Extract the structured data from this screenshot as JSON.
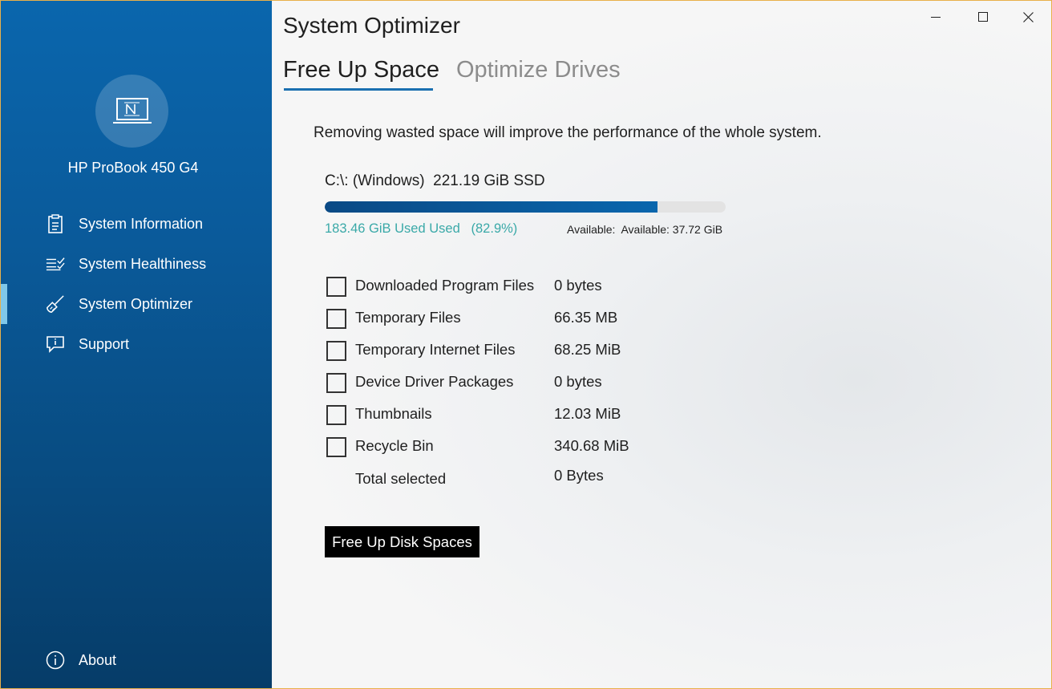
{
  "sidebar": {
    "device_name": "HP ProBook 450 G4",
    "nav_items": [
      {
        "label": "System Information",
        "icon": "clipboard-icon"
      },
      {
        "label": "System Healthiness",
        "icon": "checklist-icon"
      },
      {
        "label": "System Optimizer",
        "icon": "broom-icon",
        "active": true
      },
      {
        "label": "Support",
        "icon": "chat-info-icon"
      }
    ],
    "about_label": "About",
    "colors": {
      "top": "#0a66ad",
      "bottom": "#063c68",
      "active_indicator": "#7fc8ea"
    }
  },
  "window": {
    "title": "System Optimizer",
    "controls": [
      "minimize-icon",
      "maximize-icon",
      "close-icon"
    ]
  },
  "tabs": [
    {
      "label": "Free Up Space",
      "active": true
    },
    {
      "label": "Optimize Drives",
      "active": false
    }
  ],
  "main": {
    "description": "Removing wasted space will improve the performance of the whole system.",
    "drive": {
      "label": "C:\\: (Windows)  221.19 GiB SSD",
      "used_text": "183.46 GiB Used Used   (82.9%)",
      "used_fraction": 0.829,
      "available_text": "Available:  Available: 37.72 GiB"
    },
    "items": [
      {
        "label": "Downloaded Program Files",
        "size": "0 bytes",
        "checked": false
      },
      {
        "label": "Temporary Files",
        "size": "66.35 MB",
        "checked": false
      },
      {
        "label": "Temporary Internet Files",
        "size": "68.25 MiB",
        "checked": false
      },
      {
        "label": "Device Driver Packages",
        "size": "0 bytes",
        "checked": false
      },
      {
        "label": "Thumbnails",
        "size": "12.03 MiB",
        "checked": false
      },
      {
        "label": "Recycle Bin",
        "size": "340.68 MiB",
        "checked": false
      }
    ],
    "total_label": "Total selected",
    "total_value": "0 Bytes",
    "action_button": "Free Up Disk Spaces",
    "colors": {
      "accent": "#1a6fb0",
      "used_text": "#3aa9a8",
      "button_bg": "#000000"
    }
  }
}
